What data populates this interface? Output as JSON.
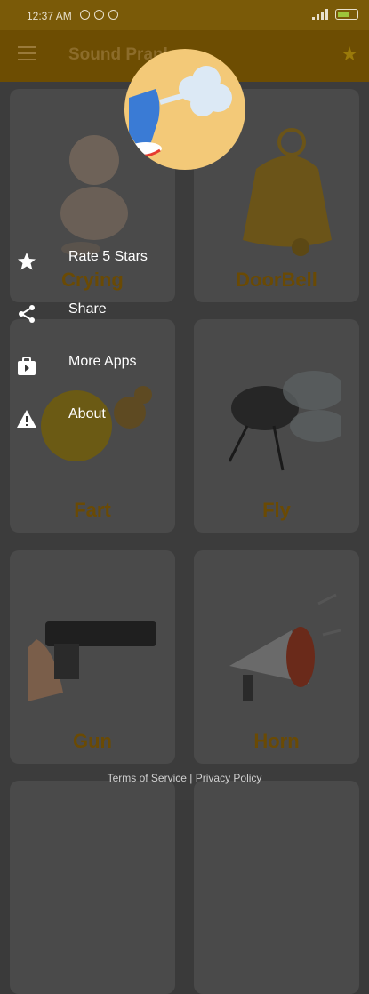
{
  "status": {
    "time": "12:37 AM"
  },
  "app": {
    "title": "Sound Prank"
  },
  "sounds": [
    {
      "label": "Crying"
    },
    {
      "label": "DoorBell"
    },
    {
      "label": "Fart"
    },
    {
      "label": "Fly"
    },
    {
      "label": "Gun"
    },
    {
      "label": "Horn"
    }
  ],
  "drawer": {
    "items": [
      {
        "label": "Rate 5 Stars",
        "icon": "star-icon"
      },
      {
        "label": "Share",
        "icon": "share-icon"
      },
      {
        "label": "More Apps",
        "icon": "play-store-icon"
      },
      {
        "label": "About",
        "icon": "warning-icon"
      }
    ]
  },
  "footer": {
    "terms": "Terms of Service",
    "separator": "|",
    "privacy": "Privacy Policy"
  }
}
